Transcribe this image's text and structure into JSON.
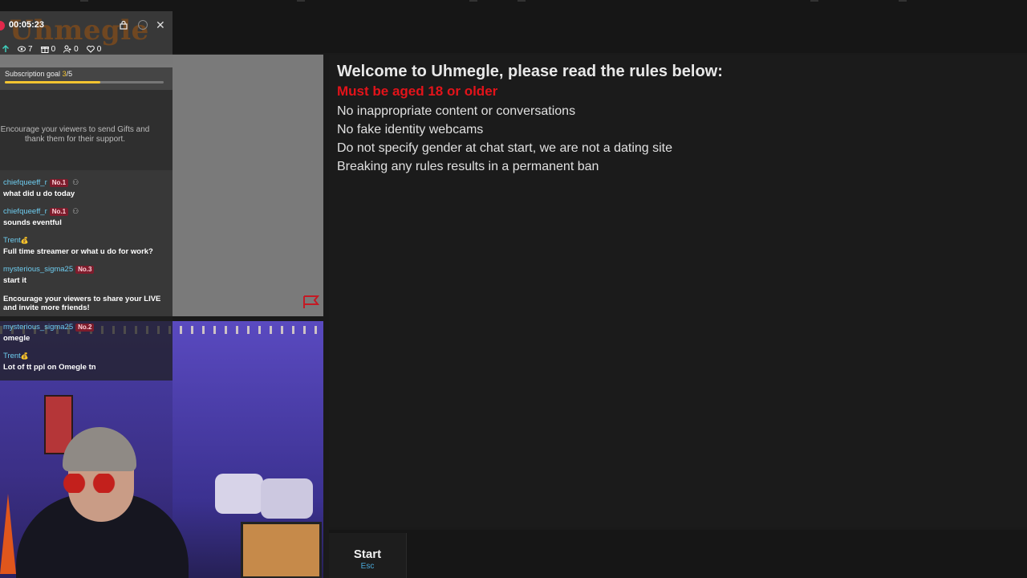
{
  "overlay": {
    "logo": "Uhmegle",
    "timer": "00:05:23",
    "stats": {
      "viewers": "7",
      "gifts": "0",
      "joined": "0",
      "likes": "0"
    },
    "goal": {
      "label": "Subscription goal",
      "current": "3",
      "separator": "/",
      "target": "5",
      "progress_fraction": 0.6
    },
    "gifts_prompt": "Encourage your viewers to send Gifts and thank them for their support.",
    "share_prompt": "Encourage your viewers to share your LIVE and invite more friends!",
    "chat": [
      {
        "user": "chiefqueeff_r",
        "badge": "No.1",
        "extra_icon": true,
        "text": "what did u do today"
      },
      {
        "user": "chiefqueeff_r",
        "badge": "No.1",
        "extra_icon": true,
        "text": "sounds eventful"
      },
      {
        "user": "Trent",
        "badge": "",
        "emoji": "💰",
        "text": "Full time streamer or what u do for work?"
      },
      {
        "user": "mysterious_sigma25",
        "badge": "No.3",
        "text": "start it"
      },
      {
        "user": "mysterious_sigma25",
        "badge": "No.2",
        "text": "omegle"
      },
      {
        "user": "Trent",
        "badge": "",
        "emoji": "💰",
        "text": "Lot of tt ppl on Omegle tn"
      }
    ]
  },
  "rules": {
    "title": "Welcome to Uhmegle, please read the rules below:",
    "warning": "Must be aged 18 or older",
    "lines": [
      "No inappropriate content or conversations",
      "No fake identity webcams",
      "Do not specify gender at chat start, we are not a dating site",
      "Breaking any rules results in a permanent ban"
    ]
  },
  "controls": {
    "start_label": "Start",
    "start_key": "Esc"
  },
  "colors": {
    "warning": "#e3131a",
    "accent": "#4aa8d8",
    "goal": "#f4c430",
    "username": "#6ecdf0"
  }
}
